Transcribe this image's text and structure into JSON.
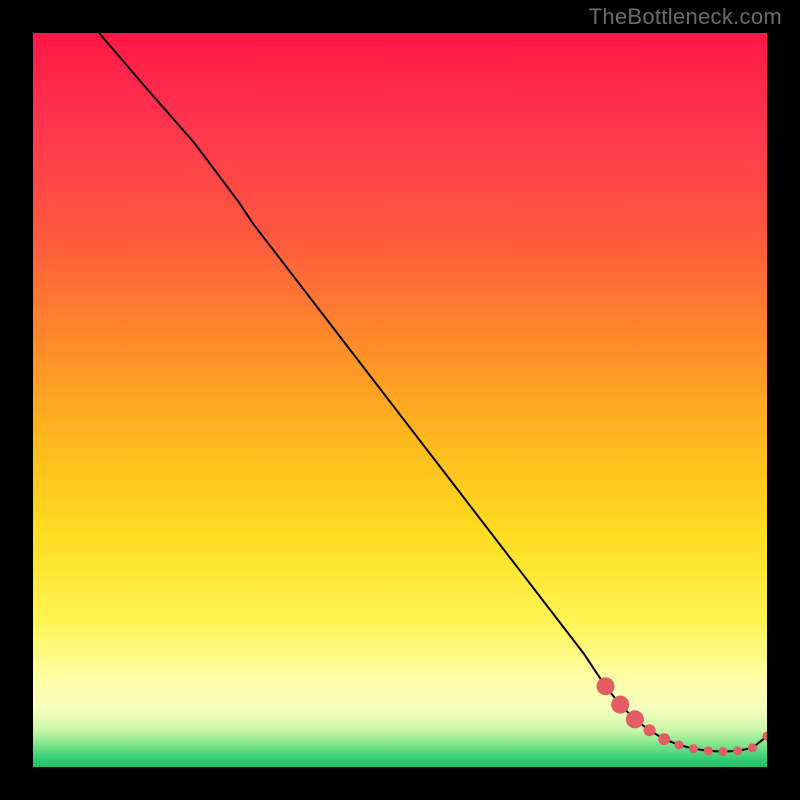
{
  "watermark": "TheBottleneck.com",
  "chart_data": {
    "type": "line",
    "title": "",
    "xlabel": "",
    "ylabel": "",
    "xlim": [
      0,
      100
    ],
    "ylim": [
      0,
      100
    ],
    "grid": false,
    "legend": false,
    "note": "Axes are unlabeled; values are read in percent of plot width/height. Higher y = top of plot.",
    "series": [
      {
        "name": "curve",
        "style": "line",
        "color": "#000000",
        "x": [
          9,
          15,
          22,
          28,
          30,
          35,
          40,
          45,
          50,
          55,
          60,
          65,
          70,
          75,
          78,
          80,
          82,
          84,
          86,
          88,
          90,
          92,
          94,
          96,
          98,
          100
        ],
        "y": [
          100,
          93,
          85,
          77,
          74,
          67.5,
          61,
          54.5,
          48,
          41.5,
          35,
          28.5,
          22,
          15.5,
          11,
          8.5,
          6.5,
          5,
          3.8,
          3,
          2.5,
          2.2,
          2.1,
          2.2,
          2.6,
          4.2
        ]
      },
      {
        "name": "markers",
        "style": "scatter",
        "color": "#e35d63",
        "x": [
          78,
          80,
          82,
          84,
          86,
          88,
          90,
          92,
          94,
          96,
          98,
          100
        ],
        "y": [
          11,
          8.5,
          6.5,
          5,
          3.8,
          3,
          2.5,
          2.2,
          2.1,
          2.2,
          2.6,
          4.2
        ],
        "radius_hint": "first few large, rest small"
      }
    ],
    "background_gradient": {
      "direction": "top-to-bottom",
      "stops": [
        {
          "pct": 0,
          "color": "#ff1744"
        },
        {
          "pct": 28,
          "color": "#ff5a3e"
        },
        {
          "pct": 55,
          "color": "#ffb71e"
        },
        {
          "pct": 80,
          "color": "#fff452"
        },
        {
          "pct": 92,
          "color": "#f7ffbe"
        },
        {
          "pct": 100,
          "color": "#20c268"
        }
      ]
    }
  }
}
